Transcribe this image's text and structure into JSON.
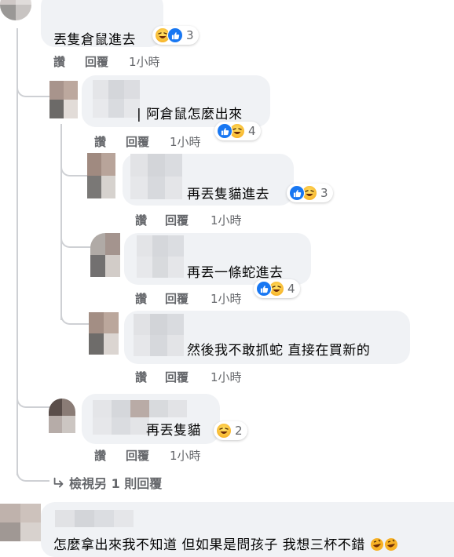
{
  "actions": {
    "like": "讚",
    "reply": "回覆"
  },
  "comments": [
    {
      "text": "丟隻倉鼠進去",
      "time": "1小時",
      "reactions": "3"
    },
    {
      "text": "| 阿倉鼠怎麼出來",
      "time": "1小時",
      "reactions": "4"
    },
    {
      "text": "再丟隻貓進去",
      "time": "1小時",
      "reactions": "3"
    },
    {
      "text": "再丟一條蛇進去",
      "time": "1小時",
      "reactions": "4"
    },
    {
      "text": "然後我不敢抓蛇 直接在買新的",
      "time": "1小時"
    },
    {
      "text": "再丟隻貓",
      "time": "1小時",
      "reactions": "2"
    },
    {
      "text": "怎麼拿出來我不知道 但如果是問孩子 我想三杯不錯"
    }
  ],
  "view_more": "檢視另 1 則回覆",
  "colors": {
    "bubble": "#f0f2f5",
    "meta": "#65676b",
    "like_blue": "#1877f2",
    "thread_line": "#ced0d4"
  }
}
